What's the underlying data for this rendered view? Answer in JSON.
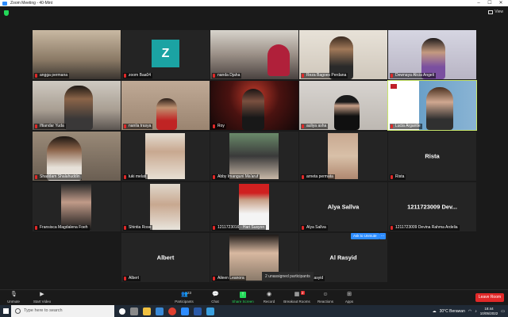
{
  "window": {
    "title": "Zoom Meeting - 40-Mint",
    "view_label": "View"
  },
  "tiles": [
    {
      "name": "angga permana"
    },
    {
      "name": "zoom Baa04",
      "avatar_letter": "Z"
    },
    {
      "name": "nanda Djaha"
    },
    {
      "name": "Reza Bagoes Perdana"
    },
    {
      "name": "Dewnaya Alicia Angeli"
    },
    {
      "name": "Iftiandar Yuda"
    },
    {
      "name": "nanila trasya"
    },
    {
      "name": "Roy"
    },
    {
      "name": "auliya asha"
    },
    {
      "name": "Lucia Argantie"
    },
    {
      "name": "Shaddam Shalahuddin"
    },
    {
      "name": "luki melati"
    },
    {
      "name": "Abby Imanguni Ma'aruf"
    },
    {
      "name": "arneta permata"
    },
    {
      "name": "Rista",
      "display_name": "Rista"
    },
    {
      "name": "Fransisca Magdalena Foeh"
    },
    {
      "name": "Shintia Rose"
    },
    {
      "name": "1211723016 - Hari Susyon"
    },
    {
      "name": "Alya Sallva",
      "display_name": "Alya Sallva"
    },
    {
      "name": "1211723009 Devina Rahma Ardelia",
      "display_name": "1211723009 Dev..."
    },
    {
      "name": "Albert",
      "display_name": "Albert"
    },
    {
      "name": "Aileen Leanora"
    },
    {
      "name": "Al Rasyid",
      "display_name": "Al Rasyid"
    }
  ],
  "overlay": {
    "ask_to_unmute": "Ask to Unmute",
    "more": "...",
    "unassigned": "2 unassigned participants"
  },
  "toolbar": {
    "unmute": "Unmute",
    "start_video": "Start Video",
    "participants": "Participants",
    "participants_count": "23",
    "chat": "Chat",
    "share_screen": "Share Screen",
    "record": "Record",
    "breakout_rooms": "Breakout Rooms",
    "breakout_count": "2",
    "reactions": "Reactions",
    "apps": "Apps",
    "leave_room": "Leave Room"
  },
  "taskbar": {
    "search_placeholder": "Type here to search",
    "weather": "30°C  Berawan",
    "time": "18:44",
    "date": "10/05/2022"
  },
  "colors": {
    "accent": "#2d8cff",
    "leave": "#e02828",
    "share": "#23d959",
    "active_speaker": "#c8e66b"
  }
}
